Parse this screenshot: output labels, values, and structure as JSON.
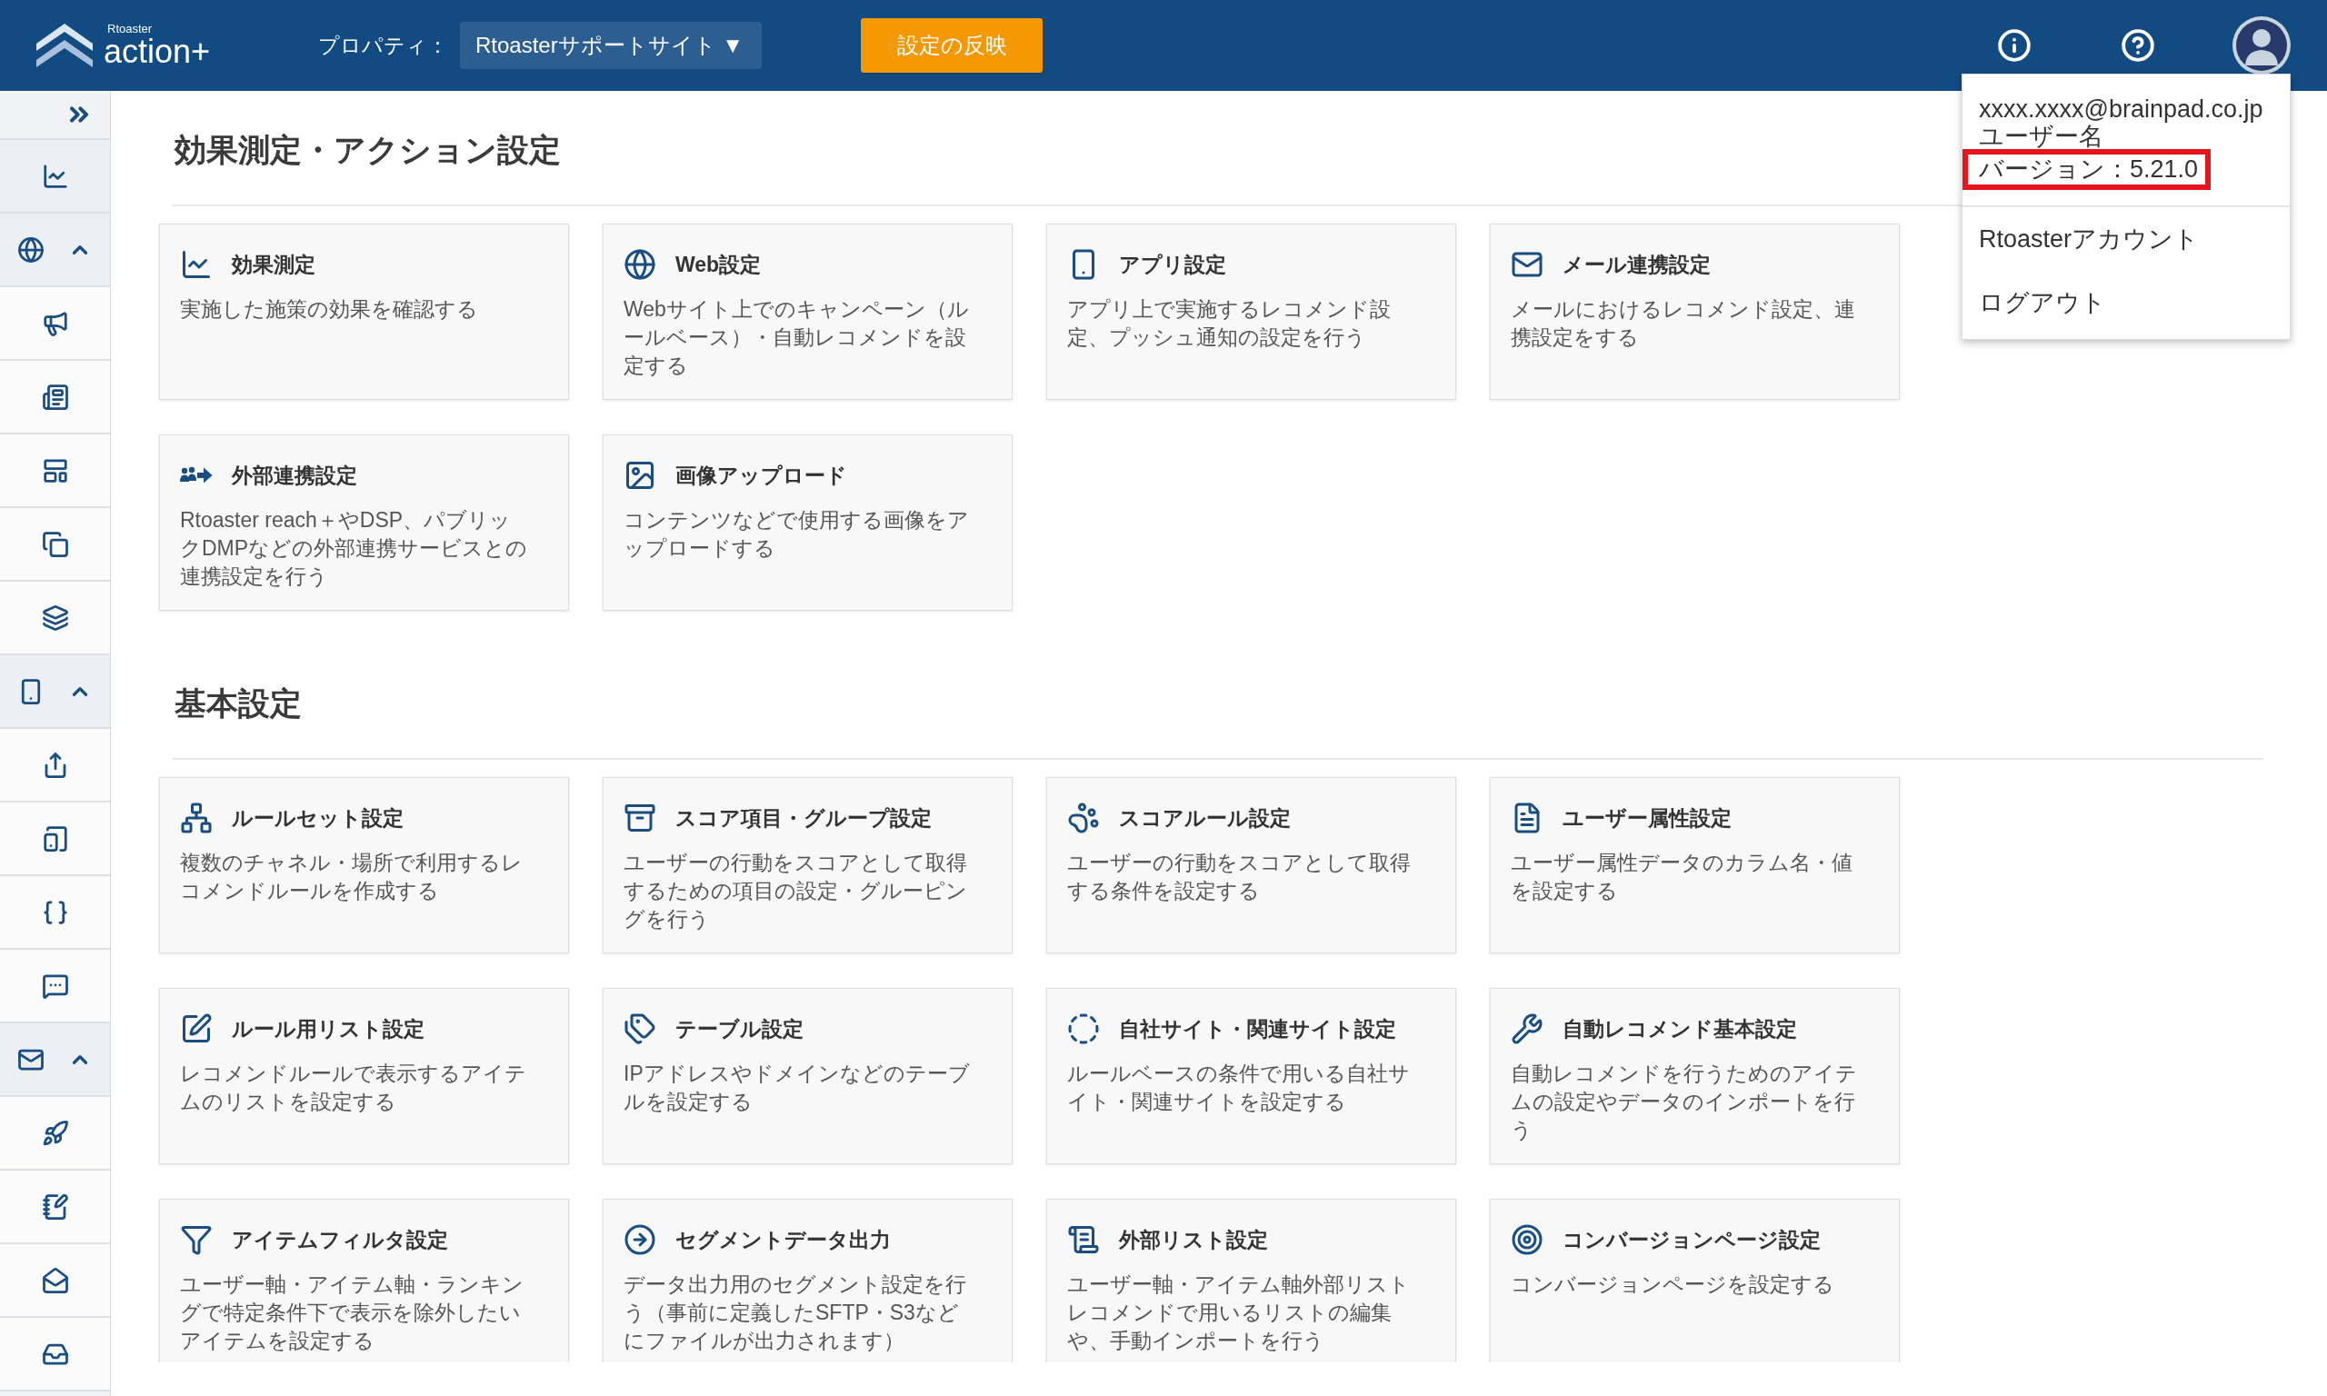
{
  "header": {
    "logo": {
      "brand": "Rtoaster",
      "product": "action+"
    },
    "property_label": "プロパティ：",
    "property_select": {
      "value": "Rtoasterサポートサイト",
      "arrow": "▼"
    },
    "apply_button": "設定の反映"
  },
  "user_menu": {
    "open": true,
    "email": "xxxx.xxxx@brainpad.co.jp",
    "user_name": "ユーザー名",
    "version": {
      "text": "バージョン：5.21.0",
      "highlighted": true
    },
    "items": [
      "Rtoasterアカウント",
      "ログアウト"
    ]
  },
  "sidebar": {
    "groups": [
      {
        "expanded": true
      },
      {
        "expanded": true
      },
      {
        "expanded": true
      }
    ]
  },
  "sections": [
    {
      "title": "効果測定・アクション設定",
      "cards": [
        {
          "title": "効果測定",
          "description": "実施した施策の効果を確認する"
        },
        {
          "title": "Web設定",
          "description": "Webサイト上でのキャンペーン（ルールベース）・自動レコメンドを設定する"
        },
        {
          "title": "アプリ設定",
          "description": "アプリ上で実施するレコメンド設定、プッシュ通知の設定を行う"
        },
        {
          "title": "メール連携設定",
          "description": "メールにおけるレコメンド設定、連携設定をする"
        },
        {
          "title": "外部連携設定",
          "description": "Rtoaster reach＋やDSP、パブリックDMPなどの外部連携サービスとの連携設定を行う"
        },
        {
          "title": "画像アップロード",
          "description": "コンテンツなどで使用する画像をアップロードする"
        }
      ]
    },
    {
      "title": "基本設定",
      "cards": [
        {
          "title": "ルールセット設定",
          "description": "複数のチャネル・場所で利用するレコメンドルールを作成する"
        },
        {
          "title": "スコア項目・グループ設定",
          "description": "ユーザーの行動をスコアとして取得するための項目の設定・グルーピングを行う"
        },
        {
          "title": "スコアルール設定",
          "description": "ユーザーの行動をスコアとして取得する条件を設定する"
        },
        {
          "title": "ユーザー属性設定",
          "description": "ユーザー属性データのカラム名・値を設定する"
        },
        {
          "title": "ルール用リスト設定",
          "description": "レコメンドルールで表示するアイテムのリストを設定する"
        },
        {
          "title": "テーブル設定",
          "description": "IPアドレスやドメインなどのテーブルを設定する"
        },
        {
          "title": "自社サイト・関連サイト設定",
          "description": "ルールベースの条件で用いる自社サイト・関連サイトを設定する"
        },
        {
          "title": "自動レコメンド基本設定",
          "description": "自動レコメンドを行うためのアイテムの設定やデータのインポートを行う"
        },
        {
          "title": "アイテムフィルタ設定",
          "description": "ユーザー軸・アイテム軸・ランキングで特定条件下で表示を除外したいアイテムを設定する"
        },
        {
          "title": "セグメントデータ出力",
          "description": "データ出力用のセグメント設定を行う（事前に定義したSFTP・S3などにファイルが出力されます）"
        },
        {
          "title": "外部リスト設定",
          "description": "ユーザー軸・アイテム軸外部リストレコメンドで用いるリストの編集や、手動インポートを行う"
        },
        {
          "title": "コンバージョンページ設定",
          "description": "コンバージョンページを設定する"
        }
      ]
    }
  ]
}
